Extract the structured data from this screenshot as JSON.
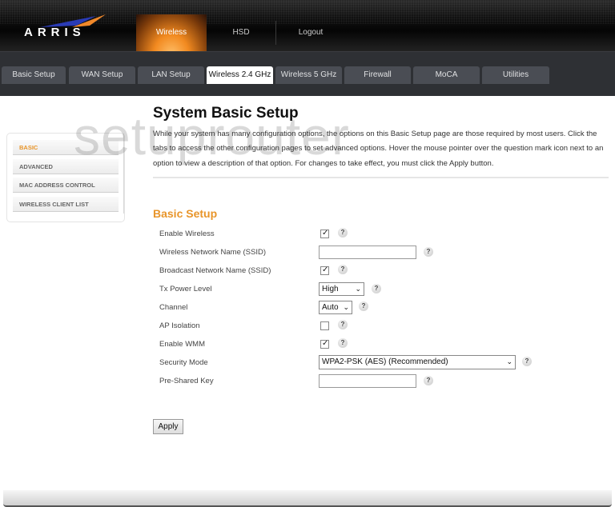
{
  "brand": {
    "logo_text": "ARRIS",
    "accent_color": "#e8952a"
  },
  "topnav": {
    "items": [
      {
        "label": "Wireless",
        "active": true
      },
      {
        "label": "HSD",
        "active": false
      },
      {
        "label": "Logout",
        "active": false
      }
    ]
  },
  "tabs": [
    {
      "label": "Basic Setup"
    },
    {
      "label": "WAN Setup"
    },
    {
      "label": "LAN Setup"
    },
    {
      "label": "Wireless 2.4 GHz",
      "active": true
    },
    {
      "label": "Wireless 5 GHz"
    },
    {
      "label": "Firewall"
    },
    {
      "label": "MoCA"
    },
    {
      "label": "Utilities"
    }
  ],
  "sidemenu": {
    "items": [
      {
        "label": "BASIC",
        "active": true
      },
      {
        "label": "ADVANCED"
      },
      {
        "label": "MAC ADDRESS CONTROL"
      },
      {
        "label": "WIRELESS CLIENT LIST"
      }
    ]
  },
  "watermark": "setuprouter",
  "main": {
    "title": "System Basic Setup",
    "intro": "While your system has many configuration options, the options on this Basic Setup page are those required by most users. Click the tabs to access the other configuration pages to set advanced options. Hover the mouse pointer over the question mark icon next to an option to view a description of that option. For changes to take effect, you must click the Apply button.",
    "section_title": "Basic Setup",
    "fields": {
      "enable_wireless": {
        "label": "Enable Wireless",
        "checked": true
      },
      "ssid": {
        "label": "Wireless Network Name (SSID)",
        "value": ""
      },
      "broadcast_ssid": {
        "label": "Broadcast Network Name (SSID)",
        "checked": true
      },
      "tx_power": {
        "label": "Tx Power Level",
        "value": "High"
      },
      "channel": {
        "label": "Channel",
        "value": "Auto"
      },
      "ap_isolation": {
        "label": "AP Isolation",
        "checked": false
      },
      "enable_wmm": {
        "label": "Enable WMM",
        "checked": true
      },
      "security_mode": {
        "label": "Security Mode",
        "value": "WPA2-PSK (AES) (Recommended)"
      },
      "psk": {
        "label": "Pre-Shared Key",
        "value": ""
      }
    },
    "help_glyph": "?",
    "check_glyph": "✓",
    "chevron_glyph": "⌄",
    "apply_label": "Apply"
  }
}
